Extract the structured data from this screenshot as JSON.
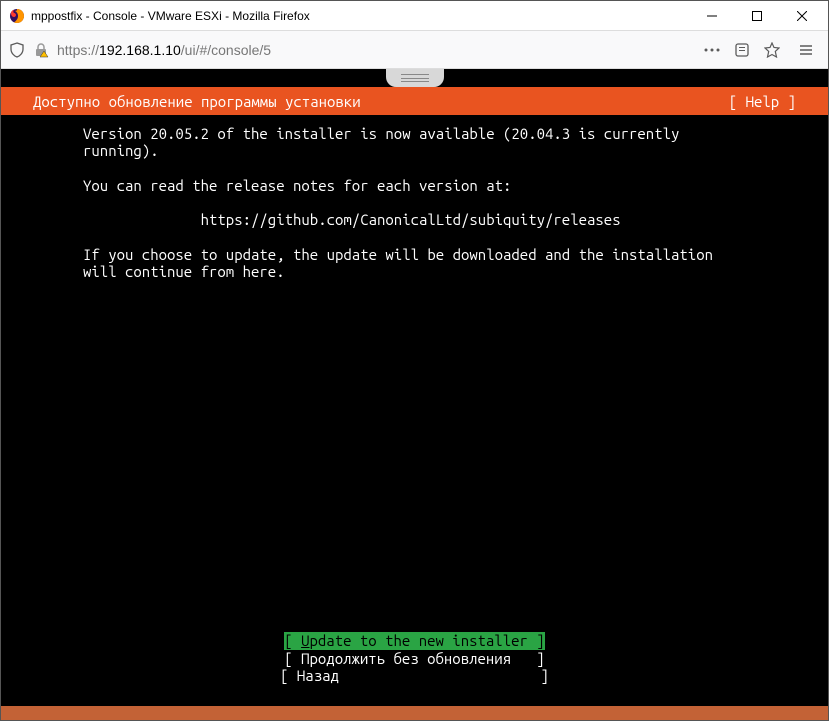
{
  "window": {
    "title": "mppostfix - Console - VMware ESXi - Mozilla Firefox"
  },
  "addressbar": {
    "url_prefix": "https://",
    "url_ip": "192.168.1.10",
    "url_path": "/ui/#/console/5"
  },
  "console": {
    "header_title": "Доступно обновление программы установки",
    "help_label": "[ Help ]",
    "body_line1": "Version 20.05.2 of the installer is now available (20.04.3 is currently",
    "body_line2": "running).",
    "body_line3": "You can read the release notes for each version at:",
    "body_url": "https://github.com/CanonicalLtd/subiquity/releases",
    "body_line4": "If you choose to update, the update will be downloaded and the installation",
    "body_line5": "will continue from here.",
    "menu": {
      "opt1_prefix": "[ ",
      "opt1_u": "U",
      "opt1_rest": "pdate to the new installer ]",
      "opt2": "[ Продолжить без обновления   ]",
      "opt3": "[ Назад                        ]"
    }
  }
}
